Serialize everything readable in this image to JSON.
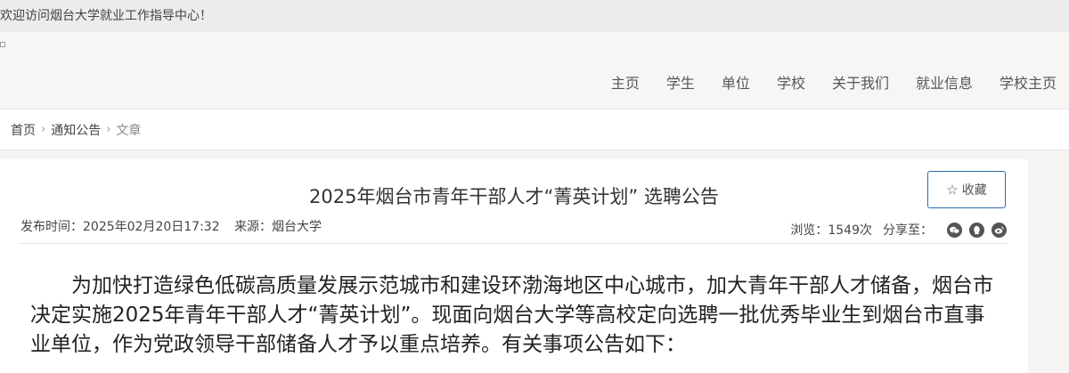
{
  "topbar": {
    "welcome": "欢迎访问烟台大学就业工作指导中心！"
  },
  "nav": {
    "items": [
      {
        "label": "主页"
      },
      {
        "label": "学生"
      },
      {
        "label": "单位"
      },
      {
        "label": "学校"
      },
      {
        "label": "关于我们"
      },
      {
        "label": "就业信息"
      },
      {
        "label": "学校主页"
      }
    ]
  },
  "breadcrumb": {
    "home": "首页",
    "section": "通知公告",
    "current": "文章",
    "separator": "›"
  },
  "article": {
    "title": "2025年烟台市青年干部人才“菁英计划” 选聘公告",
    "favorite_label": "收藏",
    "publish_time": "发布时间：2025年02月20日17:32",
    "source": "来源：烟台大学",
    "views": "浏览：1549次",
    "share_label": "分享至：",
    "share_icons": [
      "wechat-icon",
      "qq-icon",
      "weibo-icon"
    ],
    "paragraph": "为加快打造绿色低碳高质量发展示范城市和建设环渤海地区中心城市，加大青年干部人才储备，烟台市决定实施2025年青年干部人才“菁英计划”。现面向烟台大学等高校定向选聘一批优秀毕业生到烟台市直事业单位，作为党政领导干部储备人才予以重点培养。有关事项公告如下："
  },
  "colors": {
    "accent_border": "#2b6ca3",
    "page_bg": "#f5f4f2"
  }
}
